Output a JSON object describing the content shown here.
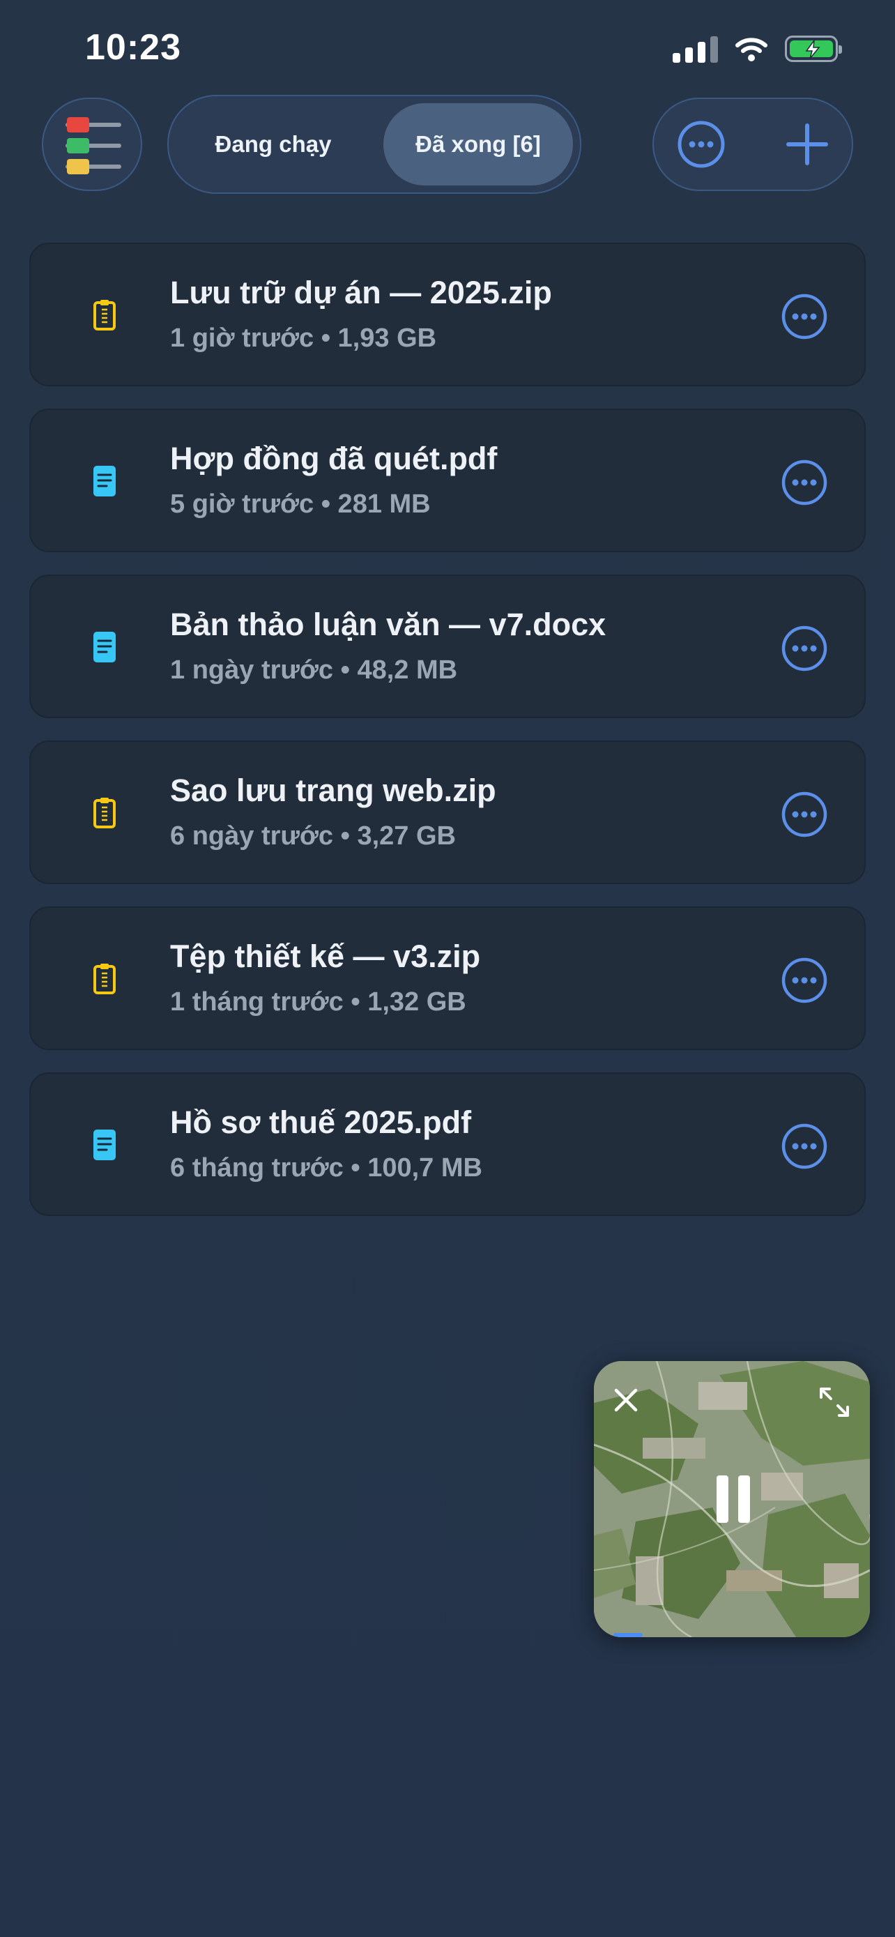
{
  "status_bar": {
    "time": "10:23"
  },
  "toolbar": {
    "tabs": [
      {
        "label": "Đang chạy",
        "selected": false
      },
      {
        "label": "Đã xong [6]",
        "selected": true
      }
    ]
  },
  "files": [
    {
      "name": "Lưu trữ dự án — 2025.zip",
      "meta": "1 giờ trước • 1,93 GB",
      "icon": "zip-icon"
    },
    {
      "name": "Hợp đồng đã quét.pdf",
      "meta": "5 giờ trước • 281 MB",
      "icon": "document-icon"
    },
    {
      "name": "Bản thảo luận văn — v7.docx",
      "meta": "1 ngày trước • 48,2 MB",
      "icon": "document-icon"
    },
    {
      "name": "Sao lưu trang web.zip",
      "meta": "6 ngày trước • 3,27 GB",
      "icon": "zip-icon"
    },
    {
      "name": "Tệp thiết kế — v3.zip",
      "meta": "1 tháng trước • 1,32 GB",
      "icon": "zip-icon"
    },
    {
      "name": "Hồ sơ thuế 2025.pdf",
      "meta": "6 tháng trước • 100,7 MB",
      "icon": "document-icon"
    }
  ],
  "colors": {
    "accent": "#5b8fe8",
    "zip_icon": "#f6c915",
    "doc_icon": "#38c6f4",
    "battery": "#34c759"
  }
}
